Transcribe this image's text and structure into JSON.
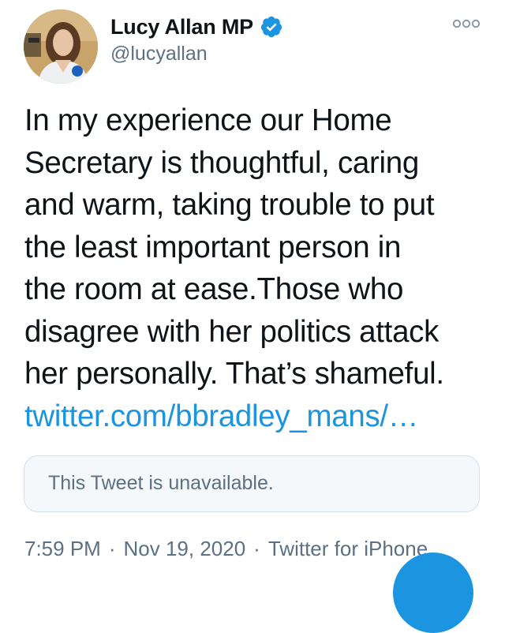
{
  "author": {
    "name": "Lucy Allan MP",
    "handle": "@lucyallan",
    "verified_icon": "verified-badge-icon",
    "avatar_icon": "profile-photo"
  },
  "menu": {
    "more_icon": "more-options-icon"
  },
  "tweet": {
    "lines": [
      "In my experience our Home",
      "Secretary is thoughtful, caring",
      "and warm, taking trouble to put",
      "the least important person in",
      "the room at ease.Those who",
      "disagree with her politics attack",
      "her personally. That’s shameful."
    ],
    "link": "twitter.com/bbradley_mans/…"
  },
  "quote": {
    "text": "This Tweet is unavailable."
  },
  "meta": {
    "time": "7:59 PM",
    "date": "Nov 19, 2020",
    "source": "Twitter for iPhone",
    "separator": "·"
  },
  "colors": {
    "accent": "#1b95e0",
    "secondary_text": "#5b7083",
    "primary_text": "#0f1419"
  }
}
